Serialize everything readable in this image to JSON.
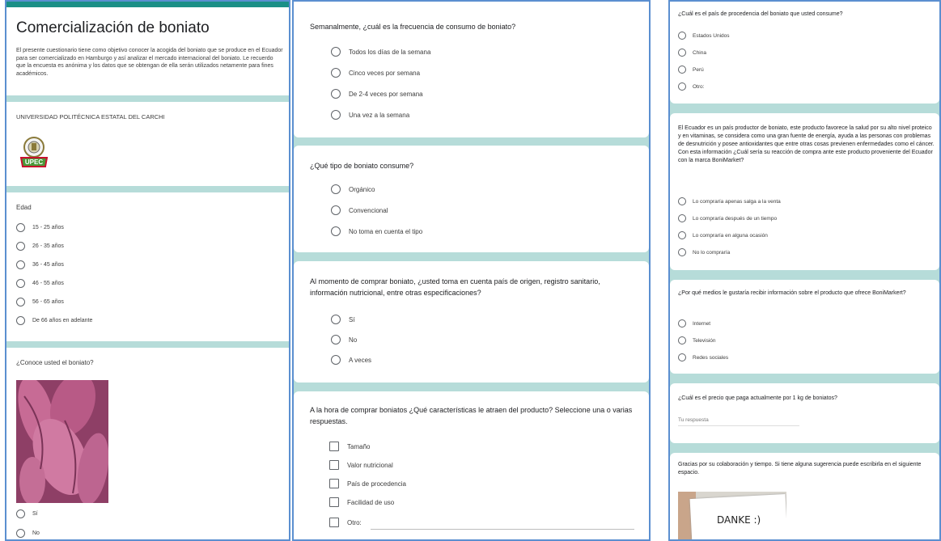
{
  "form": {
    "title": "Comercialización de boniato",
    "description": "El presente cuestionario tiene como objetivo conocer la acogida del boniato que se produce en el Ecuador para ser comercializado en Hamburgo y así analizar el mercado internacional del boniato. Le recuerdo que la encuesta es anónima y los datos que se obtengan de ella serán utilizados netamente para fines académicos.",
    "university": "UNIVERSIDAD POLITÉCNICA ESTATAL DEL CARCHI",
    "logo_text": "UPEC"
  },
  "q_age": {
    "label": "Edad",
    "options": [
      "15 - 25 años",
      "26 - 35 años",
      "36 - 45 años",
      "46 - 55 años",
      "56 - 65 años",
      "De 66 años en adelante"
    ]
  },
  "q_know": {
    "label": "¿Conoce usted el boniato?",
    "options": [
      "Sí",
      "No"
    ]
  },
  "q_freq": {
    "label": "Semanalmente, ¿cuál es la frecuencia de consumo de boniato?",
    "options": [
      "Todos los días de la semana",
      "Cinco veces por semana",
      "De 2-4 veces por semana",
      "Una vez a la semana"
    ]
  },
  "q_type": {
    "label": "¿Qué tipo de boniato consume?",
    "options": [
      "Orgánico",
      "Convencional",
      "No toma en cuenta el tipo"
    ]
  },
  "q_origin_consider": {
    "label": "Al momento de comprar boniato, ¿usted toma en cuenta país de origen, registro sanitario, información nutricional, entre otras especificaciones?",
    "options": [
      "Sí",
      "No",
      "A veces"
    ]
  },
  "q_features": {
    "label": "A la hora de comprar boniatos ¿Qué características le atraen del producto? Seleccione una o varias respuestas.",
    "options": [
      "Tamaño",
      "Valor nutricional",
      "País de procedencia",
      "Facilidad de uso",
      "Otro:"
    ]
  },
  "q_country": {
    "label": "¿Cuál es el país de procedencia del boniato que usted consume?",
    "options": [
      "Estados Unidos",
      "China",
      "Perú",
      "Otro:"
    ]
  },
  "q_reaction": {
    "label": "El Ecuador es un país productor de boniato, este producto favorece la salud por su alto nivel proteico y en vitaminas, se considera como una gran fuente de energía, ayuda a las personas con problemas de desnutrición y posee antioxidantes que entre otras cosas previenen enfermedades como el cáncer. Con esta información ¿Cuál sería su reacción de compra ante este producto proveniente del Ecuador con la marca BoniMarket?",
    "options": [
      "Lo compraría apenas salga a la venta",
      "Lo compraría después de un tiempo",
      "Lo compraría en alguna ocasión",
      "No lo compraría"
    ]
  },
  "q_media": {
    "label": "¿Por qué medios le gustaría recibir información sobre el producto que ofrece BoniMarkert?",
    "options": [
      "Internet",
      "Televisión",
      "Redes sociales"
    ]
  },
  "q_price": {
    "label": "¿Cuál es el precio que paga actualmente por 1 kg de boniatos?",
    "placeholder": "Tu respuesta"
  },
  "q_thanks": {
    "label": "Gracias por su colaboración y tiempo. Si tiene alguna sugerencia puede escribirla en el siguiente espacio.",
    "image_text": "DANKE :)"
  },
  "colors": {
    "header_bar": "#1a8f86",
    "separator": "#b6dcd9",
    "panel_border": "#5b8fd0"
  }
}
